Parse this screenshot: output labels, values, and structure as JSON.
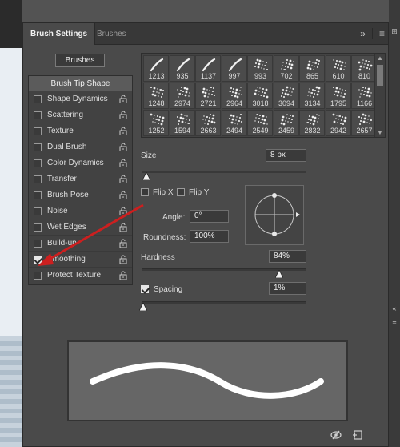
{
  "panel": {
    "tabs": [
      {
        "label": "Brush Settings",
        "active": true
      },
      {
        "label": "Brushes",
        "active": false
      }
    ],
    "collapse_icon": "double-chevron-right-icon",
    "menu_icon": "panel-menu-icon"
  },
  "brushes_button": "Brushes",
  "options": {
    "header": "Brush Tip Shape",
    "items": [
      {
        "label": "Shape Dynamics",
        "checked": false
      },
      {
        "label": "Scattering",
        "checked": false
      },
      {
        "label": "Texture",
        "checked": false
      },
      {
        "label": "Dual Brush",
        "checked": false
      },
      {
        "label": "Color Dynamics",
        "checked": false
      },
      {
        "label": "Transfer",
        "checked": false
      },
      {
        "label": "Brush Pose",
        "checked": false
      },
      {
        "label": "Noise",
        "checked": false
      },
      {
        "label": "Wet Edges",
        "checked": false
      },
      {
        "label": "Build-up",
        "checked": false
      },
      {
        "label": "Smoothing",
        "checked": true
      },
      {
        "label": "Protect Texture",
        "checked": false
      }
    ]
  },
  "tips": {
    "rows": [
      [
        "1213",
        "935",
        "1137",
        "997",
        "993",
        "702",
        "865",
        "610",
        "810"
      ],
      [
        "1248",
        "2974",
        "2721",
        "2964",
        "3018",
        "3094",
        "3134",
        "1795",
        "1166"
      ],
      [
        "1252",
        "1594",
        "2663",
        "2494",
        "2549",
        "2459",
        "2832",
        "2942",
        "2657"
      ]
    ]
  },
  "size": {
    "label": "Size",
    "value": "8 px"
  },
  "flip_x": {
    "label": "Flip X",
    "checked": false
  },
  "flip_y": {
    "label": "Flip Y",
    "checked": false
  },
  "angle": {
    "label": "Angle:",
    "value": "0°"
  },
  "roundness": {
    "label": "Roundness:",
    "value": "100%"
  },
  "hardness": {
    "label": "Hardness",
    "value": "84%",
    "fraction": 0.84
  },
  "spacing": {
    "label": "Spacing",
    "value": "1%",
    "checked": true
  },
  "colors": {
    "panel_bg": "#4a4a4a",
    "annotation_arrow": "#cc1f1f",
    "preview_stroke": "#ffffff"
  }
}
